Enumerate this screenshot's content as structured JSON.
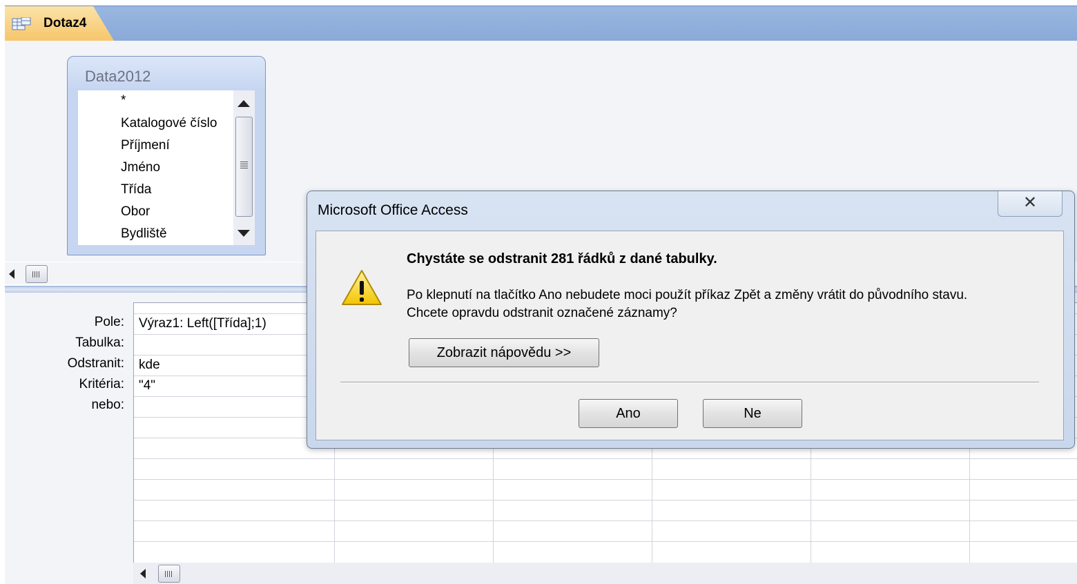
{
  "tab": {
    "label": "Dotaz4",
    "icon": "query-icon"
  },
  "table_box": {
    "title": "Data2012",
    "fields": [
      "*",
      "Katalogové číslo",
      "Příjmení",
      "Jméno",
      "Třída",
      "Obor",
      "Bydliště"
    ]
  },
  "grid": {
    "row_labels": [
      "Pole:",
      "Tabulka:",
      "Odstranit:",
      "Kritéria:",
      "nebo:"
    ],
    "column1": [
      "Výraz1: Left([Třída];1)",
      "",
      "kde",
      "\"4\"",
      ""
    ]
  },
  "dialog": {
    "title": "Microsoft Office Access",
    "close_glyph": "✕",
    "heading": "Chystáte se odstranit 281 řádků z dané tabulky.",
    "message_line1": "Po klepnutí na tlačítko Ano nebudete moci použít příkaz Zpět a změny vrátit do původního stavu.",
    "message_line2": "Chcete opravdu odstranit označené záznamy?",
    "help_button": "Zobrazit nápovědu >>",
    "yes_button": "Ano",
    "no_button": "Ne",
    "icon": "warning-icon"
  },
  "colors": {
    "tab_bar": "#8aa9d8",
    "active_tab": "#f6c66b",
    "dialog_frame": "#c9d7ec"
  }
}
